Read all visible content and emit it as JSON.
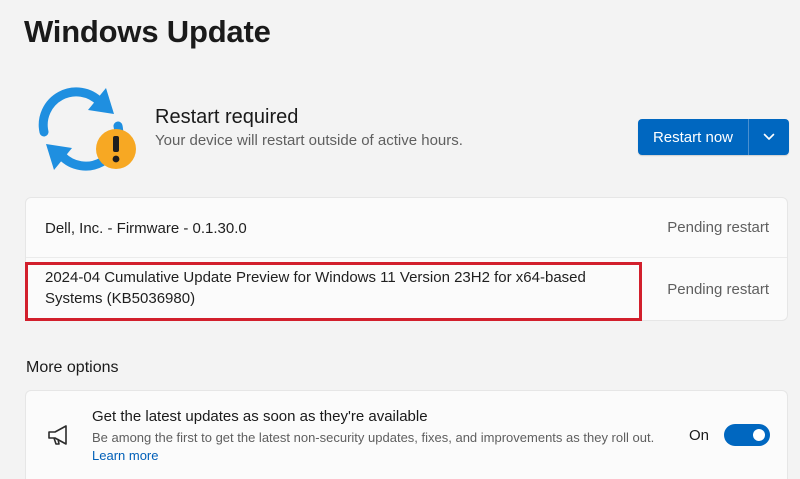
{
  "page": {
    "title": "Windows Update"
  },
  "status": {
    "title": "Restart required",
    "subtitle": "Your device will restart outside of active hours.",
    "icon": "sync-warning-icon",
    "accent_color": "#0067c0",
    "warning_color": "#f7a823"
  },
  "actions": {
    "restart_label": "Restart now",
    "dropdown_icon": "chevron-down-icon"
  },
  "updates": [
    {
      "name": "Dell, Inc. - Firmware - 0.1.30.0",
      "status": "Pending restart"
    },
    {
      "name": "2024-04 Cumulative Update Preview for Windows 11 Version 23H2 for x64-based Systems (KB5036980)",
      "status": "Pending restart",
      "highlighted": true
    }
  ],
  "more_options": {
    "heading": "More options",
    "latest_updates": {
      "icon": "megaphone-icon",
      "title": "Get the latest updates as soon as they're available",
      "description": "Be among the first to get the latest non-security updates, fixes, and improvements as they roll out.",
      "link": "Learn more",
      "toggle_state": "On",
      "toggle_on": true
    }
  },
  "highlight_color": "#d21f2c"
}
